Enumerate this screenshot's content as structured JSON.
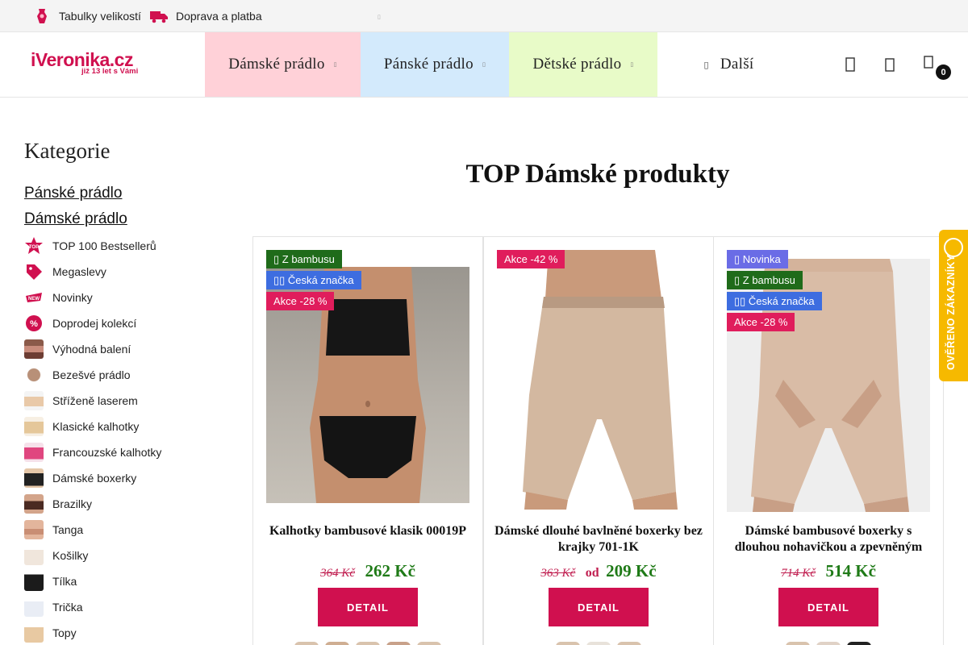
{
  "topbar": {
    "size_tables": "Tabulky velikostí",
    "shipping": "Doprava a platba"
  },
  "logo": {
    "name": "iVeronika.cz",
    "tagline": "již 13 let s Vámi"
  },
  "nav": {
    "women": "Dámské prádlo",
    "men": "Pánské prádlo",
    "kids": "Dětské prádlo",
    "more": "Další"
  },
  "header": {
    "cart_count": "0"
  },
  "sidebar": {
    "title": "Kategorie",
    "links": [
      "Pánské prádlo",
      "Dámské prádlo"
    ],
    "items": [
      "TOP 100 Bestsellerů",
      "Megaslevy",
      "Novinky",
      "Doprodej kolekcí",
      "Výhodná balení",
      "Bezešvé prádlo",
      "Stříženě laserem",
      "Klasické kalhotky",
      "Francouzské kalhotky",
      "Dámské boxerky",
      "Brazilky",
      "Tanga",
      "Košilky",
      "Tílka",
      "Trička",
      "Topy"
    ]
  },
  "main": {
    "title": "TOP Dámské produkty",
    "detail_label": "DETAIL",
    "products": [
      {
        "badges": [
          "Z bambusu",
          "Česká značka",
          "Akce -28 %"
        ],
        "name": "Kalhotky bambusové klasik 00019P",
        "old_price": "364 Kč",
        "from": "",
        "price": "262 Kč"
      },
      {
        "badges": [
          "Akce -42 %"
        ],
        "name": "Dámské dlouhé bavlněné boxerky bez krajky 701-1K",
        "old_price": "363 Kč",
        "from": "od",
        "price": "209 Kč"
      },
      {
        "badges": [
          "Novinka",
          "Z bambusu",
          "Česká značka",
          "Akce -28 %"
        ],
        "name": "Dámské bambusové boxerky s dlouhou nohavičkou a zpevněným",
        "old_price": "714 Kč",
        "from": "",
        "price": "514 Kč"
      }
    ]
  },
  "verified": {
    "label": "OVĚŘENO ZÁKAZNÍKY"
  },
  "colors": {
    "brand": "#d0104f",
    "price_green": "#1f7a17",
    "nav_women": "#ffd1d8",
    "nav_men": "#d3eafc",
    "nav_kids": "#e8fbc8"
  }
}
